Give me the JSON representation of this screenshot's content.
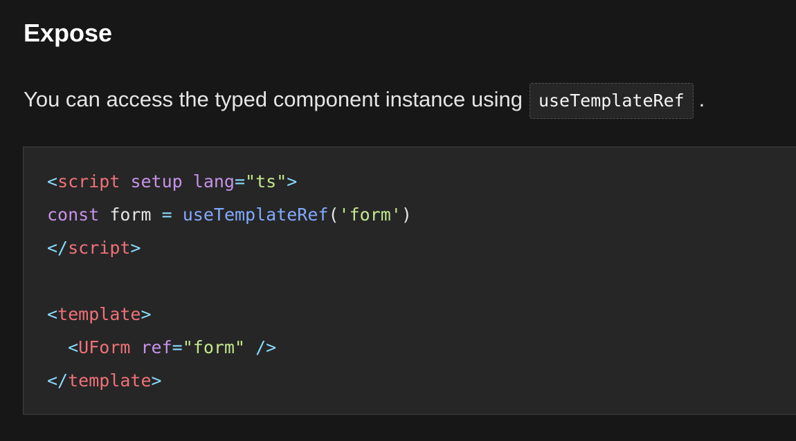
{
  "section": {
    "heading": "Expose",
    "paragraph_before": "You can access the typed component instance using",
    "inline_code": "useTemplateRef",
    "paragraph_after": "."
  },
  "code": {
    "l1": {
      "lt": "<",
      "tag": "script",
      "a1": "setup",
      "a2": "lang",
      "eq": "=",
      "v": "\"ts\"",
      "gt": ">"
    },
    "l2": {
      "kw": "const",
      "name": "form",
      "eq": "=",
      "fn": "useTemplateRef",
      "open": "(",
      "arg": "'form'",
      "close": ")"
    },
    "l3": {
      "lt": "</",
      "tag": "script",
      "gt": ">"
    },
    "l5": {
      "lt": "<",
      "tag": "template",
      "gt": ">"
    },
    "l6": {
      "lt": "<",
      "tag": "UForm",
      "attr": "ref",
      "eq": "=",
      "v": "\"form\"",
      "end": "/>"
    },
    "l7": {
      "lt": "</",
      "tag": "template",
      "gt": ">"
    }
  },
  "colors": {
    "background": "#171717",
    "code_background": "#262626",
    "tag": "#f07178",
    "punctuation": "#89ddff",
    "attribute": "#c792ea",
    "string": "#c3e88d",
    "function": "#82aaff"
  }
}
